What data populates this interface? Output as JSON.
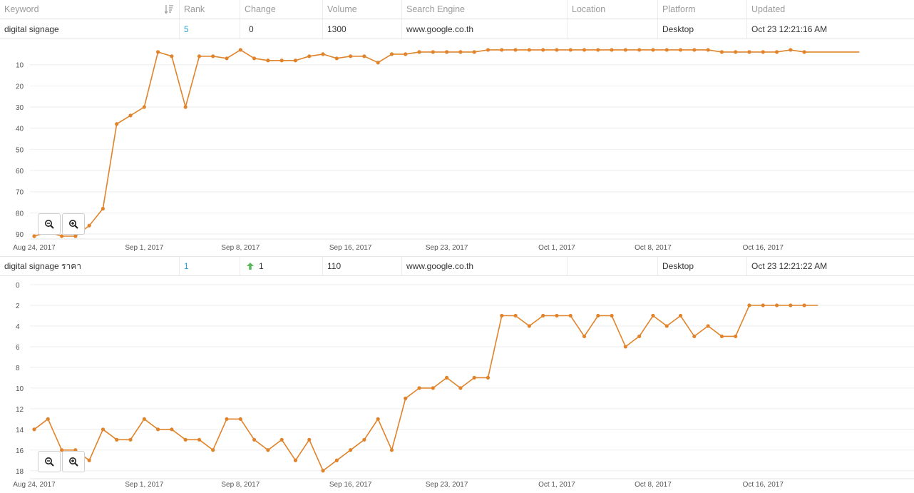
{
  "header": {
    "keyword": "Keyword",
    "rank": "Rank",
    "change": "Change",
    "volume": "Volume",
    "search_engine": "Search Engine",
    "location": "Location",
    "platform": "Platform",
    "updated": "Updated"
  },
  "rows": [
    {
      "keyword": "digital signage",
      "rank": "5",
      "change": "0",
      "change_direction": "none",
      "volume": "1300",
      "search_engine": "www.google.co.th",
      "location": "",
      "platform": "Desktop",
      "updated": "Oct 23 12:21:16 AM"
    },
    {
      "keyword": "digital signage ราคา",
      "rank": "1",
      "change": "1",
      "change_direction": "up",
      "volume": "110",
      "search_engine": "www.google.co.th",
      "location": "",
      "platform": "Desktop",
      "updated": "Oct 23 12:21:22 AM"
    }
  ],
  "colors": {
    "line": "#e0832a",
    "link": "#2a9fd8",
    "up_arrow": "#5cb85c",
    "grid": "#eeeeee"
  },
  "icons": {
    "sort": "sort-descending-icon",
    "zoom_out": "zoom-out-icon",
    "zoom_in": "zoom-in-icon",
    "up": "arrow-up-icon"
  },
  "chart_data": [
    {
      "type": "line",
      "title": "",
      "xlabel": "",
      "ylabel": "",
      "y_reversed": true,
      "ylim": [
        1,
        91
      ],
      "yticks": [
        10,
        20,
        30,
        40,
        50,
        60,
        70,
        80,
        90
      ],
      "xlim": [
        "2017-08-24",
        "2017-10-22"
      ],
      "xticks": [
        {
          "date": "2017-08-24",
          "label": "Aug 24, 2017"
        },
        {
          "date": "2017-09-01",
          "label": "Sep 1, 2017"
        },
        {
          "date": "2017-09-08",
          "label": "Sep 8, 2017"
        },
        {
          "date": "2017-09-16",
          "label": "Sep 16, 2017"
        },
        {
          "date": "2017-09-23",
          "label": "Sep 23, 2017"
        },
        {
          "date": "2017-10-01",
          "label": "Oct 1, 2017"
        },
        {
          "date": "2017-10-08",
          "label": "Oct 8, 2017"
        },
        {
          "date": "2017-10-16",
          "label": "Oct 16, 2017"
        }
      ],
      "grid": true,
      "series": [
        {
          "marker_values": [
            {
              "date": "2017-08-24",
              "rank": 91
            },
            {
              "date": "2017-08-25",
              "rank": 89
            },
            {
              "date": "2017-08-26",
              "rank": 91
            },
            {
              "date": "2017-08-27",
              "rank": 91
            },
            {
              "date": "2017-08-28",
              "rank": 86
            },
            {
              "date": "2017-08-29",
              "rank": 78
            },
            {
              "date": "2017-08-30",
              "rank": 38
            },
            {
              "date": "2017-08-31",
              "rank": 34
            },
            {
              "date": "2017-09-01",
              "rank": 30
            },
            {
              "date": "2017-09-02",
              "rank": 4
            },
            {
              "date": "2017-09-03",
              "rank": 6
            },
            {
              "date": "2017-09-04",
              "rank": 30
            },
            {
              "date": "2017-09-05",
              "rank": 6
            },
            {
              "date": "2017-09-06",
              "rank": 6
            },
            {
              "date": "2017-09-07",
              "rank": 7
            },
            {
              "date": "2017-09-08",
              "rank": 3
            },
            {
              "date": "2017-09-09",
              "rank": 7
            },
            {
              "date": "2017-09-10",
              "rank": 8
            },
            {
              "date": "2017-09-11",
              "rank": 8
            },
            {
              "date": "2017-09-12",
              "rank": 8
            },
            {
              "date": "2017-09-13",
              "rank": 6
            },
            {
              "date": "2017-09-14",
              "rank": 5
            },
            {
              "date": "2017-09-15",
              "rank": 7
            },
            {
              "date": "2017-09-16",
              "rank": 6
            },
            {
              "date": "2017-09-17",
              "rank": 6
            },
            {
              "date": "2017-09-18",
              "rank": 9
            },
            {
              "date": "2017-09-19",
              "rank": 5
            },
            {
              "date": "2017-09-20",
              "rank": 5
            },
            {
              "date": "2017-09-21",
              "rank": 4
            },
            {
              "date": "2017-09-22",
              "rank": 4
            },
            {
              "date": "2017-09-23",
              "rank": 4
            },
            {
              "date": "2017-09-24",
              "rank": 4
            },
            {
              "date": "2017-09-25",
              "rank": 4
            },
            {
              "date": "2017-09-26",
              "rank": 3
            },
            {
              "date": "2017-09-27",
              "rank": 3
            },
            {
              "date": "2017-09-28",
              "rank": 3
            },
            {
              "date": "2017-09-29",
              "rank": 3
            },
            {
              "date": "2017-09-30",
              "rank": 3
            },
            {
              "date": "2017-10-01",
              "rank": 3
            },
            {
              "date": "2017-10-02",
              "rank": 3
            },
            {
              "date": "2017-10-03",
              "rank": 3
            },
            {
              "date": "2017-10-04",
              "rank": 3
            },
            {
              "date": "2017-10-05",
              "rank": 3
            },
            {
              "date": "2017-10-06",
              "rank": 3
            },
            {
              "date": "2017-10-07",
              "rank": 3
            },
            {
              "date": "2017-10-08",
              "rank": 3
            },
            {
              "date": "2017-10-09",
              "rank": 3
            },
            {
              "date": "2017-10-10",
              "rank": 3
            },
            {
              "date": "2017-10-11",
              "rank": 3
            },
            {
              "date": "2017-10-12",
              "rank": 3
            },
            {
              "date": "2017-10-13",
              "rank": 4
            },
            {
              "date": "2017-10-14",
              "rank": 4
            },
            {
              "date": "2017-10-15",
              "rank": 4
            },
            {
              "date": "2017-10-16",
              "rank": 4
            },
            {
              "date": "2017-10-17",
              "rank": 4
            },
            {
              "date": "2017-10-18",
              "rank": 3
            },
            {
              "date": "2017-10-19",
              "rank": 4
            }
          ],
          "line_end": "2017-10-23"
        }
      ]
    },
    {
      "type": "line",
      "title": "",
      "xlabel": "",
      "ylabel": "",
      "y_reversed": true,
      "ylim": [
        0,
        18.5
      ],
      "yticks": [
        0,
        2,
        4,
        6,
        8,
        10,
        12,
        14,
        16,
        18
      ],
      "xlim": [
        "2017-08-24",
        "2017-10-22"
      ],
      "xticks": [
        {
          "date": "2017-08-24",
          "label": "Aug 24, 2017"
        },
        {
          "date": "2017-09-01",
          "label": "Sep 1, 2017"
        },
        {
          "date": "2017-09-08",
          "label": "Sep 8, 2017"
        },
        {
          "date": "2017-09-16",
          "label": "Sep 16, 2017"
        },
        {
          "date": "2017-09-23",
          "label": "Sep 23, 2017"
        },
        {
          "date": "2017-10-01",
          "label": "Oct 1, 2017"
        },
        {
          "date": "2017-10-08",
          "label": "Oct 8, 2017"
        },
        {
          "date": "2017-10-16",
          "label": "Oct 16, 2017"
        }
      ],
      "grid": true,
      "series": [
        {
          "marker_values": [
            {
              "date": "2017-08-24",
              "rank": 14
            },
            {
              "date": "2017-08-25",
              "rank": 13
            },
            {
              "date": "2017-08-26",
              "rank": 16
            },
            {
              "date": "2017-08-27",
              "rank": 16
            },
            {
              "date": "2017-08-28",
              "rank": 17
            },
            {
              "date": "2017-08-29",
              "rank": 14
            },
            {
              "date": "2017-08-30",
              "rank": 15
            },
            {
              "date": "2017-08-31",
              "rank": 15
            },
            {
              "date": "2017-09-01",
              "rank": 13
            },
            {
              "date": "2017-09-02",
              "rank": 14
            },
            {
              "date": "2017-09-03",
              "rank": 14
            },
            {
              "date": "2017-09-04",
              "rank": 15
            },
            {
              "date": "2017-09-05",
              "rank": 15
            },
            {
              "date": "2017-09-06",
              "rank": 16
            },
            {
              "date": "2017-09-07",
              "rank": 13
            },
            {
              "date": "2017-09-08",
              "rank": 13
            },
            {
              "date": "2017-09-09",
              "rank": 15
            },
            {
              "date": "2017-09-10",
              "rank": 16
            },
            {
              "date": "2017-09-11",
              "rank": 15
            },
            {
              "date": "2017-09-12",
              "rank": 17
            },
            {
              "date": "2017-09-13",
              "rank": 15
            },
            {
              "date": "2017-09-14",
              "rank": 18
            },
            {
              "date": "2017-09-15",
              "rank": 17
            },
            {
              "date": "2017-09-16",
              "rank": 16
            },
            {
              "date": "2017-09-17",
              "rank": 15
            },
            {
              "date": "2017-09-18",
              "rank": 13
            },
            {
              "date": "2017-09-19",
              "rank": 16
            },
            {
              "date": "2017-09-20",
              "rank": 11
            },
            {
              "date": "2017-09-21",
              "rank": 10
            },
            {
              "date": "2017-09-22",
              "rank": 10
            },
            {
              "date": "2017-09-23",
              "rank": 9
            },
            {
              "date": "2017-09-24",
              "rank": 10
            },
            {
              "date": "2017-09-25",
              "rank": 9
            },
            {
              "date": "2017-09-26",
              "rank": 9
            },
            {
              "date": "2017-09-27",
              "rank": 3
            },
            {
              "date": "2017-09-28",
              "rank": 3
            },
            {
              "date": "2017-09-29",
              "rank": 4
            },
            {
              "date": "2017-09-30",
              "rank": 3
            },
            {
              "date": "2017-10-01",
              "rank": 3
            },
            {
              "date": "2017-10-02",
              "rank": 3
            },
            {
              "date": "2017-10-03",
              "rank": 5
            },
            {
              "date": "2017-10-04",
              "rank": 3
            },
            {
              "date": "2017-10-05",
              "rank": 3
            },
            {
              "date": "2017-10-06",
              "rank": 6
            },
            {
              "date": "2017-10-07",
              "rank": 5
            },
            {
              "date": "2017-10-08",
              "rank": 3
            },
            {
              "date": "2017-10-09",
              "rank": 4
            },
            {
              "date": "2017-10-10",
              "rank": 3
            },
            {
              "date": "2017-10-11",
              "rank": 5
            },
            {
              "date": "2017-10-12",
              "rank": 4
            },
            {
              "date": "2017-10-13",
              "rank": 5
            },
            {
              "date": "2017-10-14",
              "rank": 5
            },
            {
              "date": "2017-10-15",
              "rank": 2
            },
            {
              "date": "2017-10-16",
              "rank": 2
            },
            {
              "date": "2017-10-17",
              "rank": 2
            },
            {
              "date": "2017-10-18",
              "rank": 2
            },
            {
              "date": "2017-10-19",
              "rank": 2
            }
          ],
          "line_end": "2017-10-20"
        }
      ]
    }
  ]
}
